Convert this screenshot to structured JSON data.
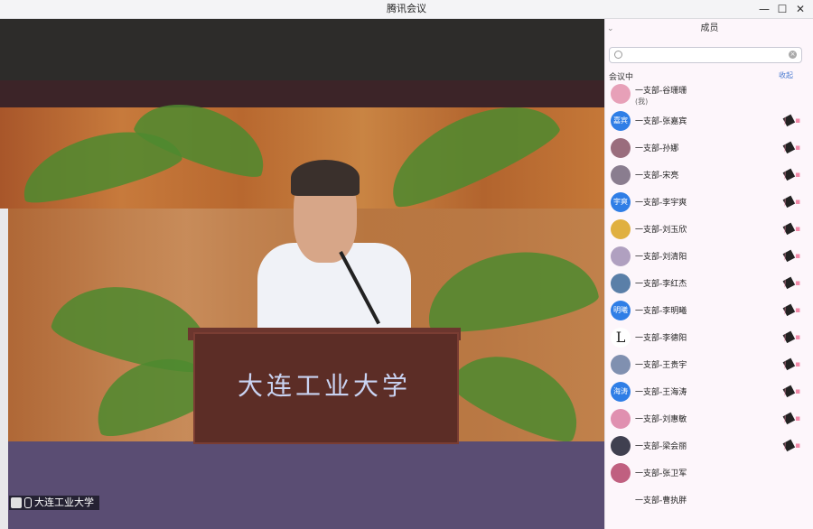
{
  "window": {
    "title": "腾讯会议",
    "min_icon": "minimize-icon",
    "max_icon": "maximize-icon",
    "close_icon": "close-icon"
  },
  "video": {
    "podium_text": "大连工业大学",
    "participant_label": "大连工业大学"
  },
  "panel": {
    "title": "成员",
    "search_placeholder": "",
    "section_label": "会议中",
    "section_action": "收起",
    "members": [
      {
        "name": "一支部-谷珊珊",
        "sub": "(我)",
        "avatar_text": "",
        "avatar_color": "#e7a0b8",
        "muted": false
      },
      {
        "name": "一支部-张嘉宾",
        "avatar_text": "嘉宾",
        "avatar_color": "#2f7ee6",
        "muted": true
      },
      {
        "name": "一支部-孙娜",
        "avatar_text": "",
        "avatar_color": "#9a6d7d",
        "muted": true
      },
      {
        "name": "一支部-宋亮",
        "avatar_text": "",
        "avatar_color": "#8a7d8f",
        "muted": true
      },
      {
        "name": "一支部-李宇爽",
        "avatar_text": "宇爽",
        "avatar_color": "#2f7ee6",
        "muted": true
      },
      {
        "name": "一支部-刘玉欣",
        "avatar_text": "",
        "avatar_color": "#e0b040",
        "muted": true
      },
      {
        "name": "一支部-刘清阳",
        "avatar_text": "",
        "avatar_color": "#b0a0c0",
        "muted": true
      },
      {
        "name": "一支部-李红杰",
        "avatar_text": "",
        "avatar_color": "#5a7fa8",
        "muted": true
      },
      {
        "name": "一支部-李明曦",
        "avatar_text": "明曦",
        "avatar_color": "#2f7ee6",
        "muted": true
      },
      {
        "name": "一支部-李德阳",
        "avatar_text": "L",
        "avatar_color": "#ffffff",
        "muted": true
      },
      {
        "name": "一支部-王贵宇",
        "avatar_text": "",
        "avatar_color": "#8090b0",
        "muted": true
      },
      {
        "name": "一支部-王海涛",
        "avatar_text": "海涛",
        "avatar_color": "#2f7ee6",
        "muted": true
      },
      {
        "name": "一支部-刘惠敏",
        "avatar_text": "",
        "avatar_color": "#e090b0",
        "muted": true
      },
      {
        "name": "一支部-梁会丽",
        "avatar_text": "",
        "avatar_color": "#404050",
        "muted": true
      },
      {
        "name": "一支部-张卫军",
        "avatar_text": "",
        "avatar_color": "#c06080",
        "muted": false
      },
      {
        "name": "一支部-曹执胖",
        "avatar_text": "",
        "avatar_color": "#fdf6fb",
        "muted": false
      }
    ]
  }
}
